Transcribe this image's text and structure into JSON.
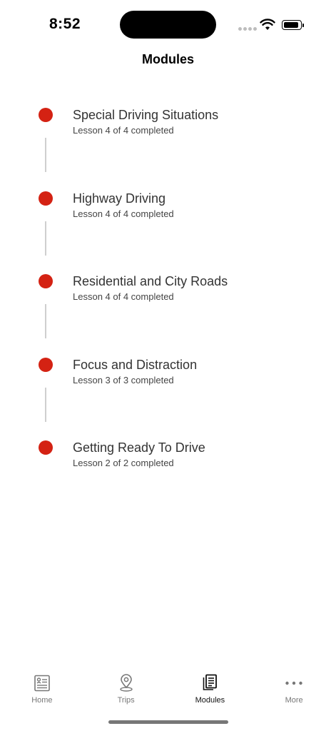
{
  "status_bar": {
    "time": "8:52"
  },
  "header": {
    "title": "Modules"
  },
  "modules": [
    {
      "title": "Special Driving Situations",
      "subtitle": "Lesson 4 of 4 completed"
    },
    {
      "title": "Highway Driving",
      "subtitle": "Lesson 4 of 4 completed"
    },
    {
      "title": "Residential and City Roads",
      "subtitle": "Lesson 4 of 4 completed"
    },
    {
      "title": "Focus and Distraction",
      "subtitle": "Lesson 3 of 3 completed"
    },
    {
      "title": "Getting Ready To Drive",
      "subtitle": "Lesson 2 of 2 completed"
    }
  ],
  "tabs": [
    {
      "label": "Home",
      "icon": "home-icon"
    },
    {
      "label": "Trips",
      "icon": "location-pin-icon"
    },
    {
      "label": "Modules",
      "icon": "documents-icon",
      "active": true
    },
    {
      "label": "More",
      "icon": "more-dots-icon"
    }
  ],
  "colors": {
    "accent": "#d42213",
    "connector": "#cfcfcf"
  }
}
